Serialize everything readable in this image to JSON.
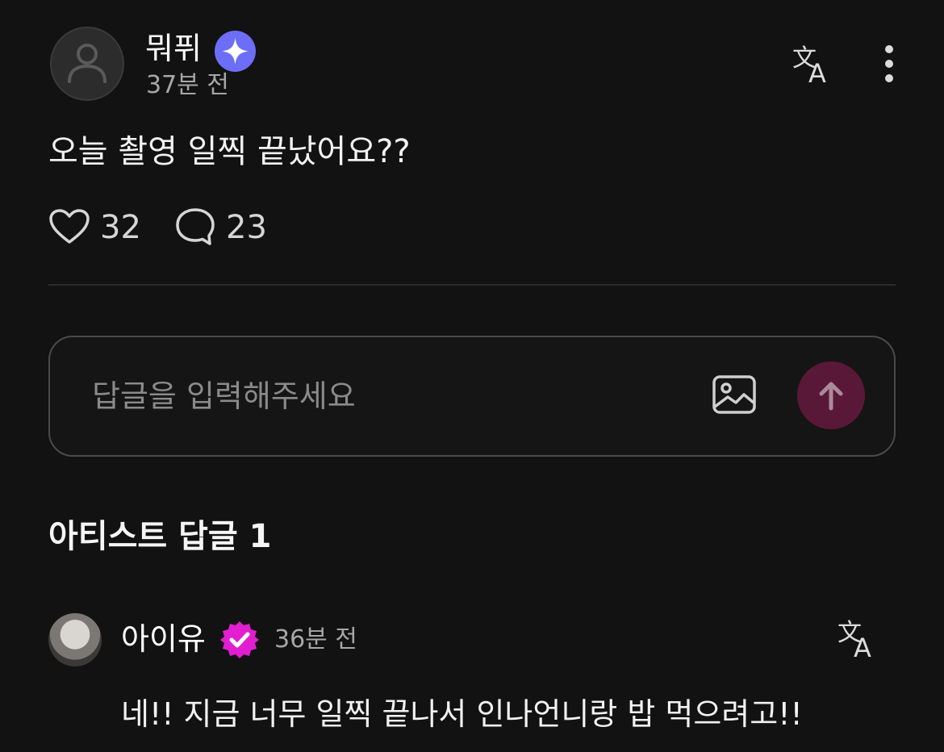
{
  "post": {
    "author": {
      "name": "뭐퓌",
      "badge_icon": "sparkle-badge-icon",
      "badge_color": "#6d6ef7",
      "time": "37분 전"
    },
    "text": "오늘 촬영 일찍 끝났어요??",
    "likes": "32",
    "comments": "23"
  },
  "reply_input": {
    "placeholder": "답글을 입력해주세요",
    "value": "",
    "send_color": "#5a1838"
  },
  "artist_section": {
    "title": "아티스트 답글 1",
    "reply": {
      "name": "아이유",
      "badge_icon": "verified-badge-icon",
      "badge_color": "#e11fd0",
      "time": "36분 전",
      "text": "네!! 지금 너무 일찍 끝나서 인나언니랑 밥 먹으려고!!"
    }
  }
}
